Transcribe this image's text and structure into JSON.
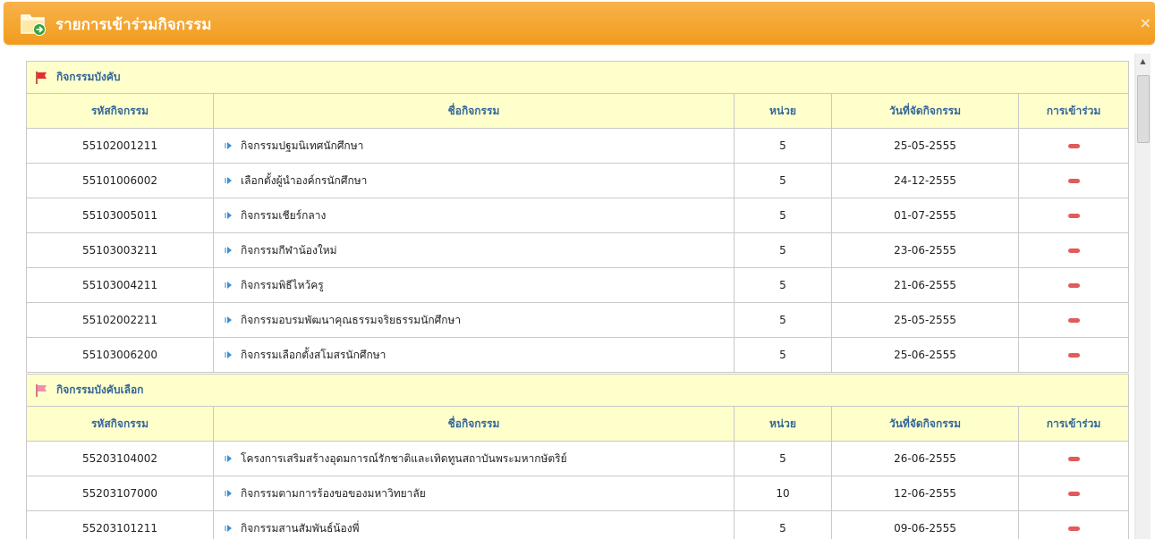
{
  "window": {
    "title": "รายการเข้าร่วมกิจกรรม",
    "close_glyph": "×",
    "accent_color": "#f29b1d"
  },
  "columns": {
    "code": "รหัสกิจกรรม",
    "name": "ชื่อกิจกรรม",
    "units": "หน่วย",
    "date": "วันที่จัดกิจกรรม",
    "attend": "การเข้าร่วม"
  },
  "sections": [
    {
      "title": "กิจกรรมบังคับ",
      "flag_icon": "red-flag-icon",
      "rows": [
        {
          "code": "55102001211",
          "name": "กิจกรรมปฐมนิเทศนักศึกษา",
          "units": "5",
          "date": "25-05-2555",
          "status_icon": "minus-icon"
        },
        {
          "code": "55101006002",
          "name": "เลือกตั้งผู้นำองค์กรนักศึกษา",
          "units": "5",
          "date": "24-12-2555",
          "status_icon": "minus-icon"
        },
        {
          "code": "55103005011",
          "name": "กิจกรรมเชียร์กลาง",
          "units": "5",
          "date": "01-07-2555",
          "status_icon": "minus-icon"
        },
        {
          "code": "55103003211",
          "name": "กิจกรรมกีฬาน้องใหม่",
          "units": "5",
          "date": "23-06-2555",
          "status_icon": "minus-icon"
        },
        {
          "code": "55103004211",
          "name": "กิจกรรมพิธีไหว้ครู",
          "units": "5",
          "date": "21-06-2555",
          "status_icon": "minus-icon"
        },
        {
          "code": "55102002211",
          "name": "กิจกรรมอบรมพัฒนาคุณธรรมจริยธรรมนักศึกษา",
          "units": "5",
          "date": "25-05-2555",
          "status_icon": "minus-icon"
        },
        {
          "code": "55103006200",
          "name": "กิจกรรมเลือกตั้งสโมสรนักศึกษา",
          "units": "5",
          "date": "25-06-2555",
          "status_icon": "minus-icon"
        }
      ]
    },
    {
      "title": "กิจกรรมบังคับเลือก",
      "flag_icon": "pink-flag-icon",
      "rows": [
        {
          "code": "55203104002",
          "name": "โครงการเสริมสร้างอุดมการณ์รักชาติและเทิดทูนสถาบันพระมหากษัตริย์",
          "units": "5",
          "date": "26-06-2555",
          "status_icon": "minus-icon"
        },
        {
          "code": "55203107000",
          "name": "กิจกรรมตามการร้องขอของมหาวิทยาลัย",
          "units": "10",
          "date": "12-06-2555",
          "status_icon": "minus-icon"
        },
        {
          "code": "55203101211",
          "name": "กิจกรรมสานสัมพันธ์น้องพี่",
          "units": "5",
          "date": "09-06-2555",
          "status_icon": "minus-icon"
        }
      ]
    }
  ]
}
